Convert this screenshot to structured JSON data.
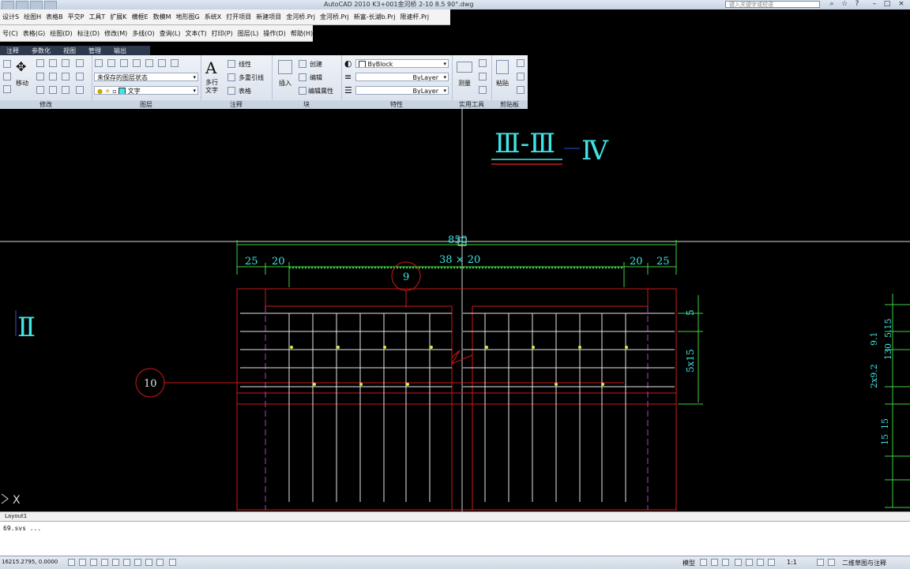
{
  "window": {
    "title": "AutoCAD 2010     K3+001金河桥 2-10 8.5 90°.dwg",
    "help_placeholder": "键入关键字或短语"
  },
  "menubar1": [
    "设计S",
    "绘图H",
    "表格B",
    "平交P",
    "工具T",
    "扩展K",
    "横框E",
    "数模M",
    "地形图G",
    "系统X",
    "打开项目",
    "新建项目",
    "金河桥.Prj",
    "金河桥.Prj",
    "新富-长湖b.Prj",
    "限速杆.Prj"
  ],
  "menubar2": [
    "号(C)",
    "表格(G)",
    "绘图(D)",
    "标注(D)",
    "修改(M)",
    "多线(O)",
    "查询(L)",
    "文本(T)",
    "打印(P)",
    "图层(L)",
    "操作(D)",
    "帮助(H)"
  ],
  "ribbon_tabs": [
    "注释",
    "参数化",
    "视图",
    "管理",
    "输出"
  ],
  "ribbon": {
    "modify_title": "修改",
    "move_label": "移动",
    "layers_title": "图层",
    "layer_state": "未保存的图层状态",
    "layer_current": "文字",
    "annot_title": "注释",
    "mtext_label": "多行\n文字",
    "linear_label": "线性",
    "mleader_label": "多重引线",
    "table_label": "表格",
    "block_title": "块",
    "insert_label": "插入",
    "create_label": "创建",
    "edit_label": "编辑",
    "editattr_label": "编辑属性",
    "props_title": "特性",
    "color_val": "ByBlock",
    "linetype_val": "ByLayer",
    "lineweight_val": "ByLayer",
    "utilities_title": "实用工具",
    "measure_label": "测量",
    "clipboard_title": "剪贴板",
    "paste_label": "粘贴"
  },
  "drawing": {
    "section_label": "Ⅲ-Ⅲ",
    "view_label_iv": "Ⅳ",
    "view_label_ii": "Ⅱ",
    "dim_total": "850",
    "dim_left1": "25",
    "dim_left2": "20",
    "dim_mid": "38 × 20",
    "dim_right1": "20",
    "dim_right2": "25",
    "callout_9": "9",
    "callout_10": "10",
    "dim_v_5": "5",
    "dim_v_5x15": "5x15",
    "dim_right_a": "2x9.2",
    "dim_right_b": "9.1",
    "dim_right_c": "5.15",
    "dim_right_d": "130",
    "dim_right_e": "15",
    "dim_right_f": "15",
    "ucs_label": "X"
  },
  "layout_tab": "Layout1",
  "cmd_history": "69.svs ...",
  "status": {
    "coords": "16215.2795, 0.0000",
    "model_label": "模型",
    "scale": "1:1",
    "workspace": "二维草图与注释"
  },
  "colors": {
    "cad_bg": "#000000",
    "cyan": "#3fe6e6",
    "green": "#3fd23f",
    "red": "#d01818",
    "magenta": "#b040c0",
    "yellow": "#e6e640"
  }
}
